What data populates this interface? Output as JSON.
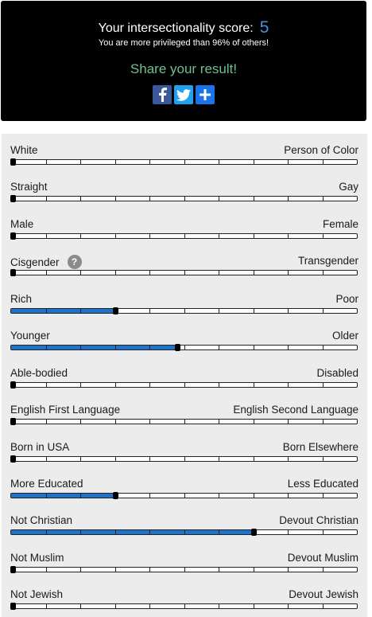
{
  "header": {
    "score_label": "Your intersectionality score:",
    "score_value": "5",
    "comparison_text": "You are more privileged than 96% of others!",
    "share_text": "Share your result!",
    "share_buttons": [
      {
        "icon": "facebook-icon"
      },
      {
        "icon": "twitter-icon"
      },
      {
        "icon": "plus-icon"
      }
    ],
    "accent_color": "#4a90d9",
    "share_color": "#6fbe8e"
  },
  "sliders": [
    {
      "left": "White",
      "right": "Person of Color",
      "value": 0
    },
    {
      "left": "Straight",
      "right": "Gay",
      "value": 0
    },
    {
      "left": "Male",
      "right": "Female",
      "value": 0
    },
    {
      "left": "Cisgender",
      "right": "Transgender",
      "value": 0,
      "help": "?"
    },
    {
      "left": "Rich",
      "right": "Poor",
      "value": 0.3
    },
    {
      "left": "Younger",
      "right": "Older",
      "value": 0.48
    },
    {
      "left": "Able-bodied",
      "right": "Disabled",
      "value": 0
    },
    {
      "left": "English First Language",
      "right": "English Second Language",
      "value": 0
    },
    {
      "left": "Born in USA",
      "right": "Born Elsewhere",
      "value": 0
    },
    {
      "left": "More Educated",
      "right": "Less Educated",
      "value": 0.3
    },
    {
      "left": "Not Christian",
      "right": "Devout Christian",
      "value": 0.7
    },
    {
      "left": "Not Muslim",
      "right": "Devout Muslim",
      "value": 0
    },
    {
      "left": "Not Jewish",
      "right": "Devout Jewish",
      "value": 0
    }
  ],
  "fill_color": "#1e73c8"
}
